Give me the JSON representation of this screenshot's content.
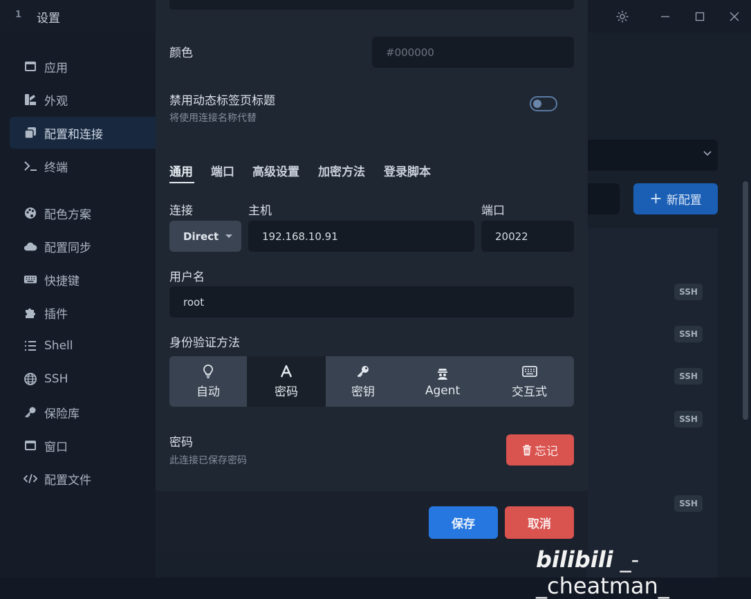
{
  "window": {
    "tab_number": "1",
    "tab_title": "设置",
    "icons": [
      "gear-icon",
      "minimize-icon",
      "maximize-icon",
      "close-icon"
    ]
  },
  "sidebar": {
    "items": [
      {
        "label": "应用",
        "icon": "app-window-icon"
      },
      {
        "label": "外观",
        "icon": "paint-icon"
      },
      {
        "label": "配置和连接",
        "icon": "profiles-icon",
        "active": true
      },
      {
        "label": "终端",
        "icon": "terminal-icon"
      },
      {
        "label": "配色方案",
        "icon": "palette-icon"
      },
      {
        "label": "配置同步",
        "icon": "cloud-icon"
      },
      {
        "label": "快捷键",
        "icon": "keyboard-icon"
      },
      {
        "label": "插件",
        "icon": "puzzle-icon"
      },
      {
        "label": "Shell",
        "icon": "list-icon"
      },
      {
        "label": "SSH",
        "icon": "globe-icon"
      },
      {
        "label": "保险库",
        "icon": "key-icon"
      },
      {
        "label": "窗口",
        "icon": "window-icon"
      },
      {
        "label": "配置文件",
        "icon": "code-icon"
      }
    ]
  },
  "background": {
    "new_config_label": "新配置",
    "ssh_badge": "SSH"
  },
  "modal": {
    "color_label": "颜色",
    "color_placeholder": "#000000",
    "disable_dynamic_title_label": "禁用动态标签页标题",
    "disable_dynamic_title_sub": "将使用连接名称代替",
    "disable_dynamic_title_on": false,
    "tabs": [
      "通用",
      "端口",
      "高级设置",
      "加密方法",
      "登录脚本"
    ],
    "active_tab": "通用",
    "connection_label": "连接",
    "connection_value": "Direct",
    "host_label": "主机",
    "host_value": "192.168.10.91",
    "port_label": "端口",
    "port_value": "20022",
    "username_label": "用户名",
    "username_value": "root",
    "auth_label": "身份验证方法",
    "auth_methods": [
      {
        "label": "自动",
        "icon": "lightbulb-icon"
      },
      {
        "label": "密码",
        "icon": "font-icon",
        "active": true
      },
      {
        "label": "密钥",
        "icon": "key-icon"
      },
      {
        "label": "Agent",
        "icon": "agent-icon"
      },
      {
        "label": "交互式",
        "icon": "keyboard-icon"
      }
    ],
    "password_label": "密码",
    "password_sub": "此连接已保存密码",
    "forget_label": "忘记",
    "save_label": "保存",
    "cancel_label": "取消"
  },
  "watermark": {
    "logo": "bilibili",
    "text": "_-_cheatman_"
  },
  "colors": {
    "accent": "#2678e0",
    "danger": "#d9534f",
    "new_config": "#1b5fb5"
  }
}
